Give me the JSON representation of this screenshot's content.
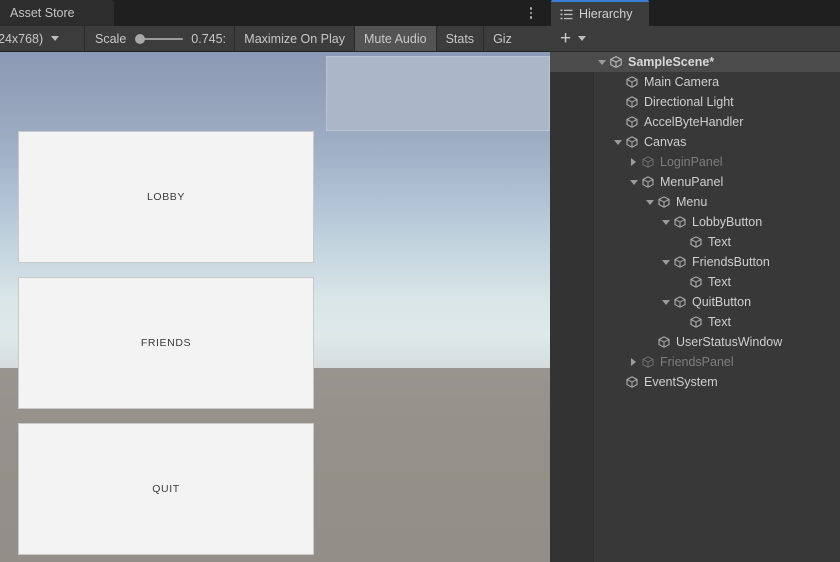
{
  "game_panel": {
    "tabs": [
      {
        "label": "Asset Store",
        "icon": "store-icon",
        "active": false
      }
    ],
    "kebab_menu_icon": "kebab-menu-icon",
    "toolbar": {
      "resolution_label": "24x768)",
      "resolution_caret_icon": "chevron-down-icon",
      "scale_label": "Scale",
      "scale_value": "0.745:",
      "maximize_on_play": "Maximize On Play",
      "mute_audio": "Mute Audio",
      "stats": "Stats",
      "gizmos": "Giz"
    },
    "canvas": {
      "buttons": [
        {
          "id": "lobby",
          "label": "LOBBY"
        },
        {
          "id": "friends",
          "label": "FRIENDS"
        },
        {
          "id": "quit",
          "label": "QUIT"
        }
      ],
      "user_status_window": "UserStatusWindow"
    },
    "colors": {
      "sky_top": "#8c9ab5",
      "sky_horizon": "#dfe9ea",
      "ground": "#959089",
      "button_fill": "#f3f3f3",
      "status_window_fill": "#abb6c8"
    }
  },
  "hierarchy_panel": {
    "tab": {
      "label": "Hierarchy",
      "icon": "hierarchy-icon",
      "active": true,
      "accent": "#3b7fd4"
    },
    "toolbar": {
      "add_label": "",
      "add_icon": "plus-icon",
      "add_caret_icon": "chevron-down-icon"
    },
    "tree": [
      {
        "label": "SampleScene*",
        "depth": 0,
        "twisty": "open",
        "icon": "scene-icon",
        "selected": true,
        "dim": false
      },
      {
        "label": "Main Camera",
        "depth": 1,
        "twisty": "none",
        "icon": "gameobject-icon",
        "selected": false,
        "dim": false
      },
      {
        "label": "Directional Light",
        "depth": 1,
        "twisty": "none",
        "icon": "gameobject-icon",
        "selected": false,
        "dim": false
      },
      {
        "label": "AccelByteHandler",
        "depth": 1,
        "twisty": "none",
        "icon": "gameobject-icon",
        "selected": false,
        "dim": false
      },
      {
        "label": "Canvas",
        "depth": 1,
        "twisty": "open",
        "icon": "gameobject-icon",
        "selected": false,
        "dim": false
      },
      {
        "label": "LoginPanel",
        "depth": 2,
        "twisty": "closed",
        "icon": "gameobject-icon",
        "selected": false,
        "dim": true
      },
      {
        "label": "MenuPanel",
        "depth": 2,
        "twisty": "open",
        "icon": "gameobject-icon",
        "selected": false,
        "dim": false
      },
      {
        "label": "Menu",
        "depth": 3,
        "twisty": "open",
        "icon": "gameobject-icon",
        "selected": false,
        "dim": false
      },
      {
        "label": "LobbyButton",
        "depth": 4,
        "twisty": "open",
        "icon": "gameobject-icon",
        "selected": false,
        "dim": false
      },
      {
        "label": "Text",
        "depth": 5,
        "twisty": "none",
        "icon": "gameobject-icon",
        "selected": false,
        "dim": false
      },
      {
        "label": "FriendsButton",
        "depth": 4,
        "twisty": "open",
        "icon": "gameobject-icon",
        "selected": false,
        "dim": false
      },
      {
        "label": "Text",
        "depth": 5,
        "twisty": "none",
        "icon": "gameobject-icon",
        "selected": false,
        "dim": false
      },
      {
        "label": "QuitButton",
        "depth": 4,
        "twisty": "open",
        "icon": "gameobject-icon",
        "selected": false,
        "dim": false
      },
      {
        "label": "Text",
        "depth": 5,
        "twisty": "none",
        "icon": "gameobject-icon",
        "selected": false,
        "dim": false
      },
      {
        "label": "UserStatusWindow",
        "depth": 3,
        "twisty": "none",
        "icon": "gameobject-icon",
        "selected": false,
        "dim": false
      },
      {
        "label": "FriendsPanel",
        "depth": 2,
        "twisty": "closed",
        "icon": "gameobject-icon",
        "selected": false,
        "dim": true
      },
      {
        "label": "EventSystem",
        "depth": 1,
        "twisty": "none",
        "icon": "gameobject-icon",
        "selected": false,
        "dim": false
      }
    ]
  }
}
